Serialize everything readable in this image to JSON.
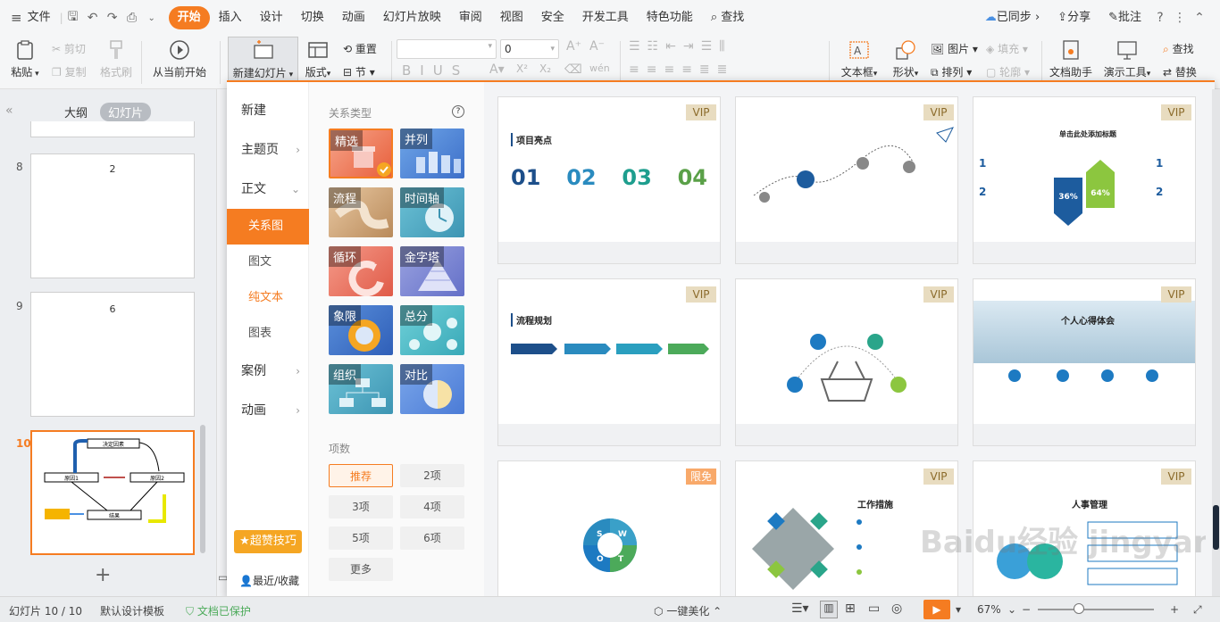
{
  "menu": {
    "file": "文件",
    "tabs": [
      "开始",
      "插入",
      "设计",
      "切换",
      "动画",
      "幻灯片放映",
      "审阅",
      "视图",
      "安全",
      "开发工具",
      "特色功能"
    ],
    "search": "查找",
    "sync": "已同步",
    "share": "分享",
    "comment": "批注"
  },
  "ribbon": {
    "paste": "粘贴",
    "cut": "剪切",
    "copy": "复制",
    "format_painter": "格式刷",
    "from_current": "从当前开始",
    "new_slide": "新建幻灯片",
    "layout": "版式",
    "section": "节",
    "reset": "重置",
    "font_size": "0",
    "text_box": "文本框",
    "shape": "形状",
    "arrange": "排列",
    "picture": "图片",
    "fill": "填充",
    "outline": "轮廓",
    "doc_helper": "文档助手",
    "present_tool": "演示工具",
    "find": "查找",
    "replace": "替换"
  },
  "left_panel": {
    "tab_outline": "大纲",
    "tab_slides": "幻灯片",
    "slides": [
      {
        "num": "8",
        "label": "2"
      },
      {
        "num": "9",
        "label": "6"
      },
      {
        "num": "10",
        "label": ""
      }
    ],
    "flow": {
      "top": "决定因素",
      "left": "原因1",
      "right": "原因2",
      "bottom": "结果"
    }
  },
  "dropdown": {
    "categories": [
      {
        "label": "新建",
        "chev": ""
      },
      {
        "label": "主题页",
        "chev": "›"
      },
      {
        "label": "正文",
        "chev": "⌄"
      },
      {
        "label": "关系图",
        "chev": ""
      },
      {
        "label": "图文",
        "chev": ""
      },
      {
        "label": "纯文本",
        "chev": ""
      },
      {
        "label": "图表",
        "chev": ""
      },
      {
        "label": "案例",
        "chev": "›"
      },
      {
        "label": "动画",
        "chev": "›"
      }
    ],
    "tips": "超赞技巧",
    "recent": "最近/收藏",
    "relation_title": "关系类型",
    "types": [
      "精选",
      "并列",
      "流程",
      "时间轴",
      "循环",
      "金字塔",
      "象限",
      "总分",
      "组织",
      "对比"
    ],
    "count_title": "项数",
    "counts": [
      "推荐",
      "2项",
      "3项",
      "4项",
      "5项",
      "6项",
      "更多"
    ],
    "cards": [
      {
        "badge": "VIP",
        "title": "项目亮点"
      },
      {
        "badge": "VIP",
        "title": ""
      },
      {
        "badge": "VIP",
        "title": "单击此处添加标题"
      },
      {
        "badge": "VIP",
        "title": "流程规划"
      },
      {
        "badge": "VIP",
        "title": ""
      },
      {
        "badge": "VIP",
        "title": "个人心得体会"
      },
      {
        "badge": "限免",
        "title": ""
      },
      {
        "badge": "VIP",
        "title": "工作措施"
      },
      {
        "badge": "VIP",
        "title": "人事管理"
      }
    ],
    "card1_nums": [
      "01",
      "02",
      "03",
      "04"
    ],
    "card2_pct": [
      "36%",
      "64%"
    ],
    "swot": [
      "S",
      "W",
      "O",
      "T"
    ]
  },
  "status": {
    "slide_info": "幻灯片 10 / 10",
    "template": "默认设计模板",
    "protected": "文档已保护",
    "beautify": "一键美化",
    "zoom": "67%"
  },
  "watermark": "Baidu经验 jingyan.baidu.com",
  "colors": {
    "accent": "#f57c21"
  }
}
